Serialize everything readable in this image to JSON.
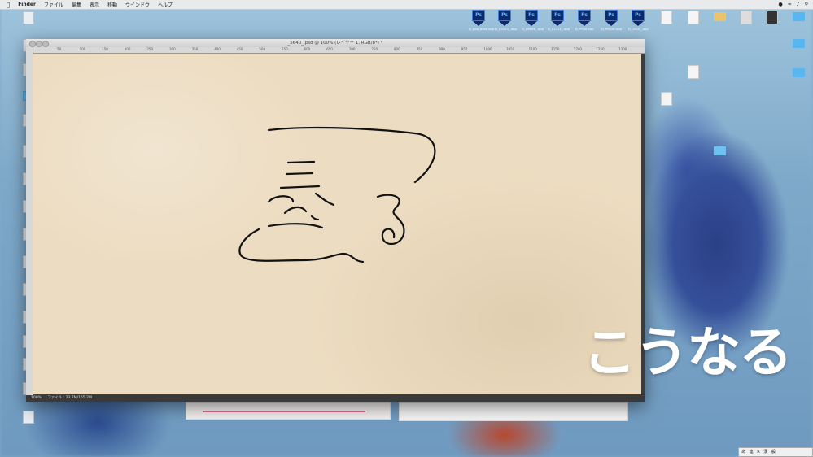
{
  "menubar": {
    "app": "Finder",
    "items": [
      "ファイル",
      "編集",
      "表示",
      "移動",
      "ウインドウ",
      "ヘルプ"
    ]
  },
  "desktop_ps_icons": [
    {
      "label": "D_pop_base.app"
    },
    {
      "label": "D_b3333_.app"
    },
    {
      "label": "D_h8666_.app"
    },
    {
      "label": "D_h1111_.app"
    },
    {
      "label": "D_iPGai.app"
    },
    {
      "label": "D_PNGnt.app"
    },
    {
      "label": "D_1920_.app"
    }
  ],
  "ps_window": {
    "title": "_5640_.psd @ 100% (レイヤー 1, RGB/8*) *",
    "ruler_ticks": [
      "50",
      "100",
      "150",
      "200",
      "250",
      "300",
      "350",
      "400",
      "450",
      "500",
      "550",
      "600",
      "650",
      "700",
      "750",
      "800",
      "850",
      "900",
      "950",
      "1000",
      "1050",
      "1100",
      "1150",
      "1200",
      "1250",
      "1300"
    ],
    "zoom": "100%",
    "file_info": "ファイル : 23.7M/165.2M"
  },
  "ime": {
    "items": [
      "あ",
      "連",
      "R",
      "漢",
      "般"
    ]
  },
  "caption": "こうなる",
  "colors": {
    "canvas": "#ecdcc1",
    "ink": "#111111",
    "caption": "#ffffff",
    "ps_icon": "#0d2a6b"
  }
}
